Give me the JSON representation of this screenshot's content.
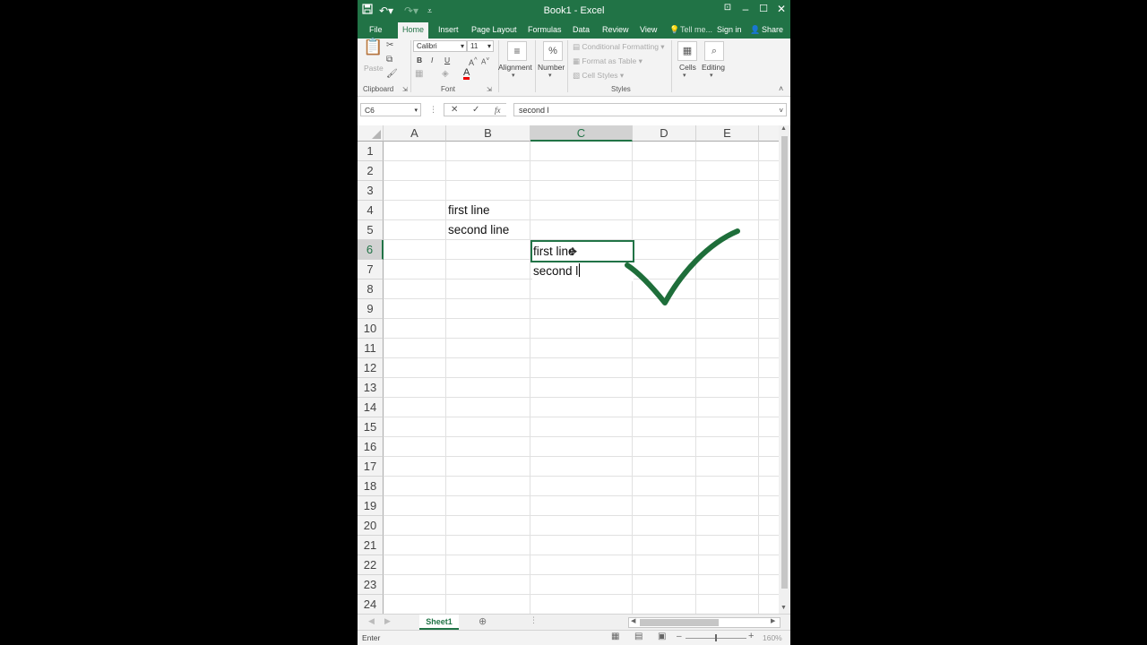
{
  "window": {
    "title": "Book1 - Excel"
  },
  "qat": {
    "save_icon": "save-icon",
    "undo_icon": "undo-icon",
    "redo_icon": "redo-icon"
  },
  "tabs": [
    {
      "label": "File"
    },
    {
      "label": "Home"
    },
    {
      "label": "Insert"
    },
    {
      "label": "Page Layout"
    },
    {
      "label": "Formulas"
    },
    {
      "label": "Data"
    },
    {
      "label": "Review"
    },
    {
      "label": "View"
    }
  ],
  "tellme": "Tell me...",
  "signin": "Sign in",
  "share": "Share",
  "ribbon": {
    "paste": "Paste",
    "clipboard": "Clipboard",
    "font_name": "Calibri",
    "font_size": "11",
    "bold": "B",
    "italic": "I",
    "underline": "U",
    "font_color_glyph": "A",
    "font_label": "Font",
    "alignment": "Alignment",
    "number": "Number",
    "conditional_formatting": "Conditional Formatting",
    "format_as_table": "Format as Table",
    "cell_styles": "Cell Styles",
    "styles": "Styles",
    "cells": "Cells",
    "editing": "Editing"
  },
  "formula_bar": {
    "name_box": "C6",
    "formula": "second l",
    "fx": "fx"
  },
  "columns": [
    "A",
    "B",
    "C",
    "D",
    "E"
  ],
  "rows": [
    "1",
    "2",
    "3",
    "4",
    "5",
    "6",
    "7",
    "8",
    "9",
    "10",
    "11",
    "12",
    "13",
    "14",
    "15",
    "16",
    "17",
    "18",
    "19",
    "20",
    "21",
    "22",
    "23",
    "24"
  ],
  "cells": {
    "B4": "first line",
    "B5": "second line"
  },
  "editor": {
    "line1": "first line",
    "line2": "second l"
  },
  "sheet": {
    "tab": "Sheet1"
  },
  "status": {
    "mode": "Enter",
    "zoom": "160%"
  },
  "colors": {
    "excel_green": "#217346",
    "check_green": "#1e6e3a"
  }
}
